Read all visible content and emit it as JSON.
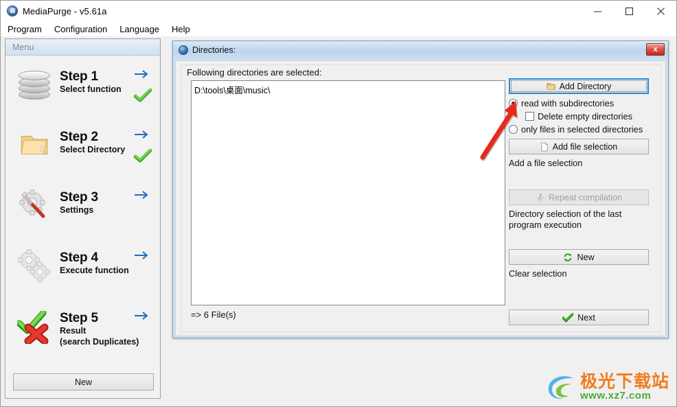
{
  "window": {
    "title": "MediaPurge - v5.61a",
    "icon": "app-icon",
    "controls": {
      "minimize": "–",
      "maximize": "□",
      "close": "✕"
    }
  },
  "menubar": {
    "items": [
      {
        "label": "Program"
      },
      {
        "label": "Configuration"
      },
      {
        "label": "Language"
      },
      {
        "label": "Help"
      }
    ]
  },
  "sidebar": {
    "header": "Menu",
    "new_button": "New",
    "steps": [
      {
        "title": "Step 1",
        "sub": "Select function",
        "sub2": "",
        "icon": "disc-stack-icon",
        "done": true
      },
      {
        "title": "Step 2",
        "sub": "Select Directory",
        "sub2": "",
        "icon": "folder-icon",
        "done": true
      },
      {
        "title": "Step 3",
        "sub": "Settings",
        "sub2": "",
        "icon": "gear-screwdriver-icon",
        "done": false
      },
      {
        "title": "Step 4",
        "sub": "Execute function",
        "sub2": "",
        "icon": "gears-icon",
        "done": false
      },
      {
        "title": "Step 5",
        "sub": "Result",
        "sub2": "(search Duplicates)",
        "icon": "check-cross-icon",
        "done": false
      }
    ]
  },
  "dialog": {
    "title": "Directories:",
    "close_label": "x",
    "list_label": "Following directories are selected:",
    "list_items": [
      "D:\\tools\\桌面\\music\\"
    ],
    "status": "=> 6 File(s)",
    "right_panel": {
      "add_directory_button": "Add Directory",
      "radio_subdirs": "read with subdirectories",
      "checkbox_delete_empty": "Delete empty directories",
      "radio_only_files": "only files in selected directories",
      "add_file_selection_button": "Add file selection",
      "add_file_selection_desc": "Add a file selection",
      "repeat_compilation_button": "Repeat compilation",
      "repeat_compilation_desc": "Directory selection of the last program execution",
      "new_button": "New",
      "new_desc": "Clear selection",
      "next_button": "Next"
    }
  },
  "watermark": {
    "cn": "极光下载站",
    "url": "www.xz7.com"
  },
  "colors": {
    "accent_blue": "#1a6fc4",
    "check_green": "#4caf2f",
    "close_red": "#c12a21",
    "focus_blue": "#2a8ad4",
    "annotation_red": "#e8291c",
    "watermark_orange": "#f07c1e",
    "watermark_green": "#4aa93a"
  }
}
